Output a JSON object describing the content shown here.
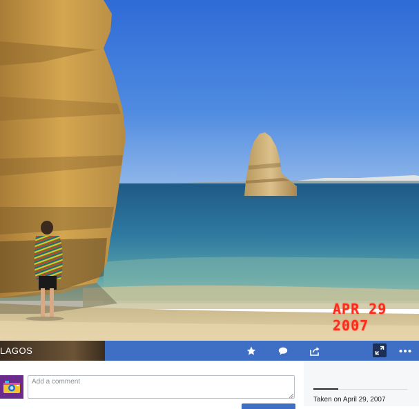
{
  "photo": {
    "date_stamp": "APR 29 2007"
  },
  "action_bar": {
    "title": "LAGOS",
    "icons": [
      "star-icon",
      "comment-icon",
      "share-icon",
      "expand-icon",
      "more-icon"
    ]
  },
  "comment": {
    "placeholder": "Add a comment"
  },
  "side_info": {
    "taken_on": "Taken on April 29, 2007"
  },
  "colors": {
    "action_bar": "#3f6fc4",
    "date_stamp": "#ff2a1a",
    "avatar_bg": "#6b2b8c"
  }
}
